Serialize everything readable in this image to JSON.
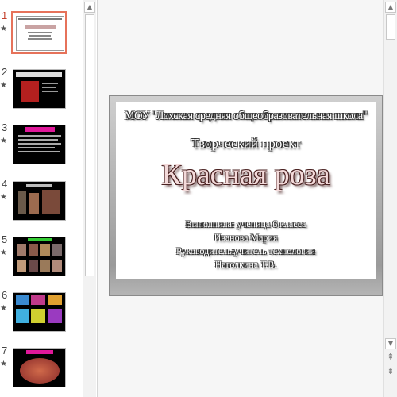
{
  "thumbnails": [
    {
      "number": "1",
      "star": "★",
      "selected": true
    },
    {
      "number": "2",
      "star": "★",
      "selected": false
    },
    {
      "number": "3",
      "star": "★",
      "selected": false
    },
    {
      "number": "4",
      "star": "★",
      "selected": false
    },
    {
      "number": "5",
      "star": "★",
      "selected": false
    },
    {
      "number": "6",
      "star": "★",
      "selected": false
    },
    {
      "number": "7",
      "star": "★",
      "selected": false
    }
  ],
  "slide": {
    "school": "МОУ \"Лохская средняя общеобразовательная школа\"",
    "project": "Творческий проект",
    "title": "Красная роза",
    "authors": [
      "Выполнила: ученица 6 класса",
      "Иванова Мария",
      "Руководитель:учитель технологии",
      "Наголкина Т.В."
    ]
  },
  "scroll": {
    "up_icon": "▲",
    "down_icon": "▼",
    "prev_slide_icon": "⇞",
    "next_slide_icon": "⇟"
  },
  "colors": {
    "selection_border": "#e6725a",
    "selected_number": "#c4402c"
  }
}
